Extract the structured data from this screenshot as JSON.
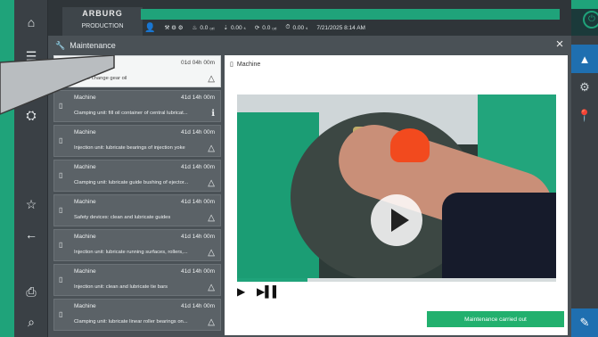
{
  "header": {
    "logo": "ARBURG",
    "mode": "PRODUCTION",
    "status": [
      {
        "icon": "temperature-icon",
        "value": "0.0 ₀ᵣᵢ"
      },
      {
        "icon": "pressure-icon",
        "value": "0.00 ₛ"
      },
      {
        "icon": "cycle-icon",
        "value": "0.0 ₀ᵣᵢ"
      },
      {
        "icon": "timer-icon",
        "value": "0.00 ₛ"
      }
    ],
    "datetime": "7/21/2025  8:14 AM"
  },
  "panel": {
    "title": "Maintenance",
    "close": "×"
  },
  "tasks": [
    {
      "name": "",
      "time": "01d 04h 00m",
      "desc": "Injection unit: change gear oil",
      "flag": "△",
      "selected": true
    },
    {
      "name": "Machine",
      "time": "41d 14h 00m",
      "desc": "Clamping unit: fill oil container of central lubricat...",
      "flag": "ℹ",
      "selected": false
    },
    {
      "name": "Machine",
      "time": "41d 14h 00m",
      "desc": "Injection unit: lubricate bearings of injection yoke",
      "flag": "△",
      "selected": false
    },
    {
      "name": "Machine",
      "time": "41d 14h 00m",
      "desc": "Clamping unit: lubricate guide bushing of ejector...",
      "flag": "△",
      "selected": false
    },
    {
      "name": "Machine",
      "time": "41d 14h 00m",
      "desc": "Safety devices: clean and lubricate guides",
      "flag": "△",
      "selected": false
    },
    {
      "name": "Machine",
      "time": "41d 14h 00m",
      "desc": "Injection unit: lubricate running surfaces, rollers,...",
      "flag": "△",
      "selected": false
    },
    {
      "name": "Machine",
      "time": "41d 14h 00m",
      "desc": "Injection unit: clean and lubricate tie bars",
      "flag": "△",
      "selected": false
    },
    {
      "name": "Machine",
      "time": "41d 14h 00m",
      "desc": "Clamping unit: lubricate linear roller bearings on...",
      "flag": "△",
      "selected": false
    }
  ],
  "detail": {
    "title": "Machine",
    "progress": 0.22,
    "play_label": "▶",
    "step_label": "▶▌▌",
    "done_label": "Maintenance carried out"
  },
  "sidebar_left": {
    "items": [
      "⌂",
      "☰",
      "⛭",
      "☆",
      "←",
      "⎙",
      "⌕"
    ]
  },
  "colors": {
    "accent_green": "#1fa37a",
    "active_blue": "#1f6fb0"
  }
}
